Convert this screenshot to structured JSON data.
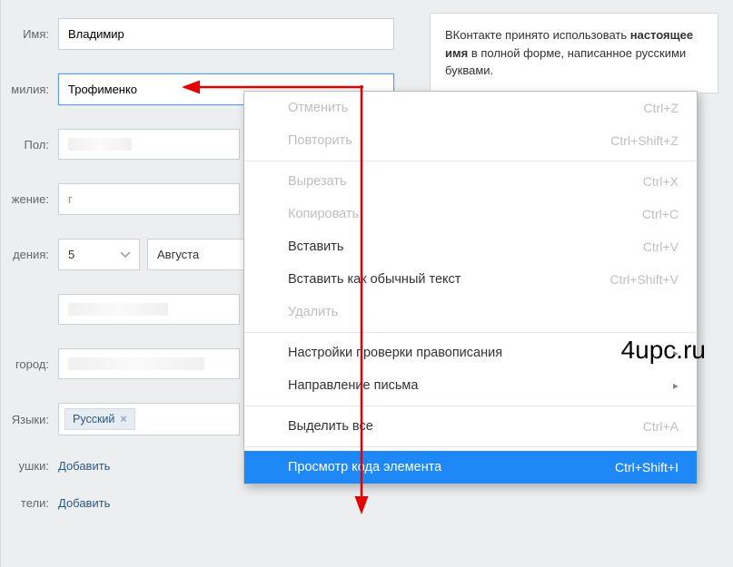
{
  "form": {
    "name_label": "Имя:",
    "name_value": "Владимир",
    "surname_label": "милия:",
    "surname_value": "Трофименко",
    "gender_label": "Пол:",
    "gender_value": "",
    "marital_label": "жение:",
    "marital_value": "г",
    "birthday_label": "дения:",
    "birthday_day": "5",
    "birthday_month": "Августа",
    "city_label": "город:",
    "city_value": "",
    "languages_label": "Языки:",
    "lang_tag": "Русский",
    "grandma_label": "ушки:",
    "parents_label": "тели:",
    "add_link": "Добавить"
  },
  "hint": {
    "text_before": "ВКонтакте принято использовать ",
    "text_bold": "настоящее имя",
    "text_after": " в полной форме, написанное русскими буквами."
  },
  "menu": {
    "undo": "Отменить",
    "undo_sc": "Ctrl+Z",
    "redo": "Повторить",
    "redo_sc": "Ctrl+Shift+Z",
    "cut": "Вырезать",
    "cut_sc": "Ctrl+X",
    "copy": "Копировать",
    "copy_sc": "Ctrl+C",
    "paste": "Вставить",
    "paste_sc": "Ctrl+V",
    "paste_plain": "Вставить как обычный текст",
    "paste_plain_sc": "Ctrl+Shift+V",
    "delete": "Удалить",
    "spellcheck": "Настройки проверки правописания",
    "direction": "Направление письма",
    "select_all": "Выделить все",
    "select_all_sc": "Ctrl+A",
    "inspect": "Просмотр кода элемента",
    "inspect_sc": "Ctrl+Shift+I"
  },
  "watermark": "4upc.ru"
}
